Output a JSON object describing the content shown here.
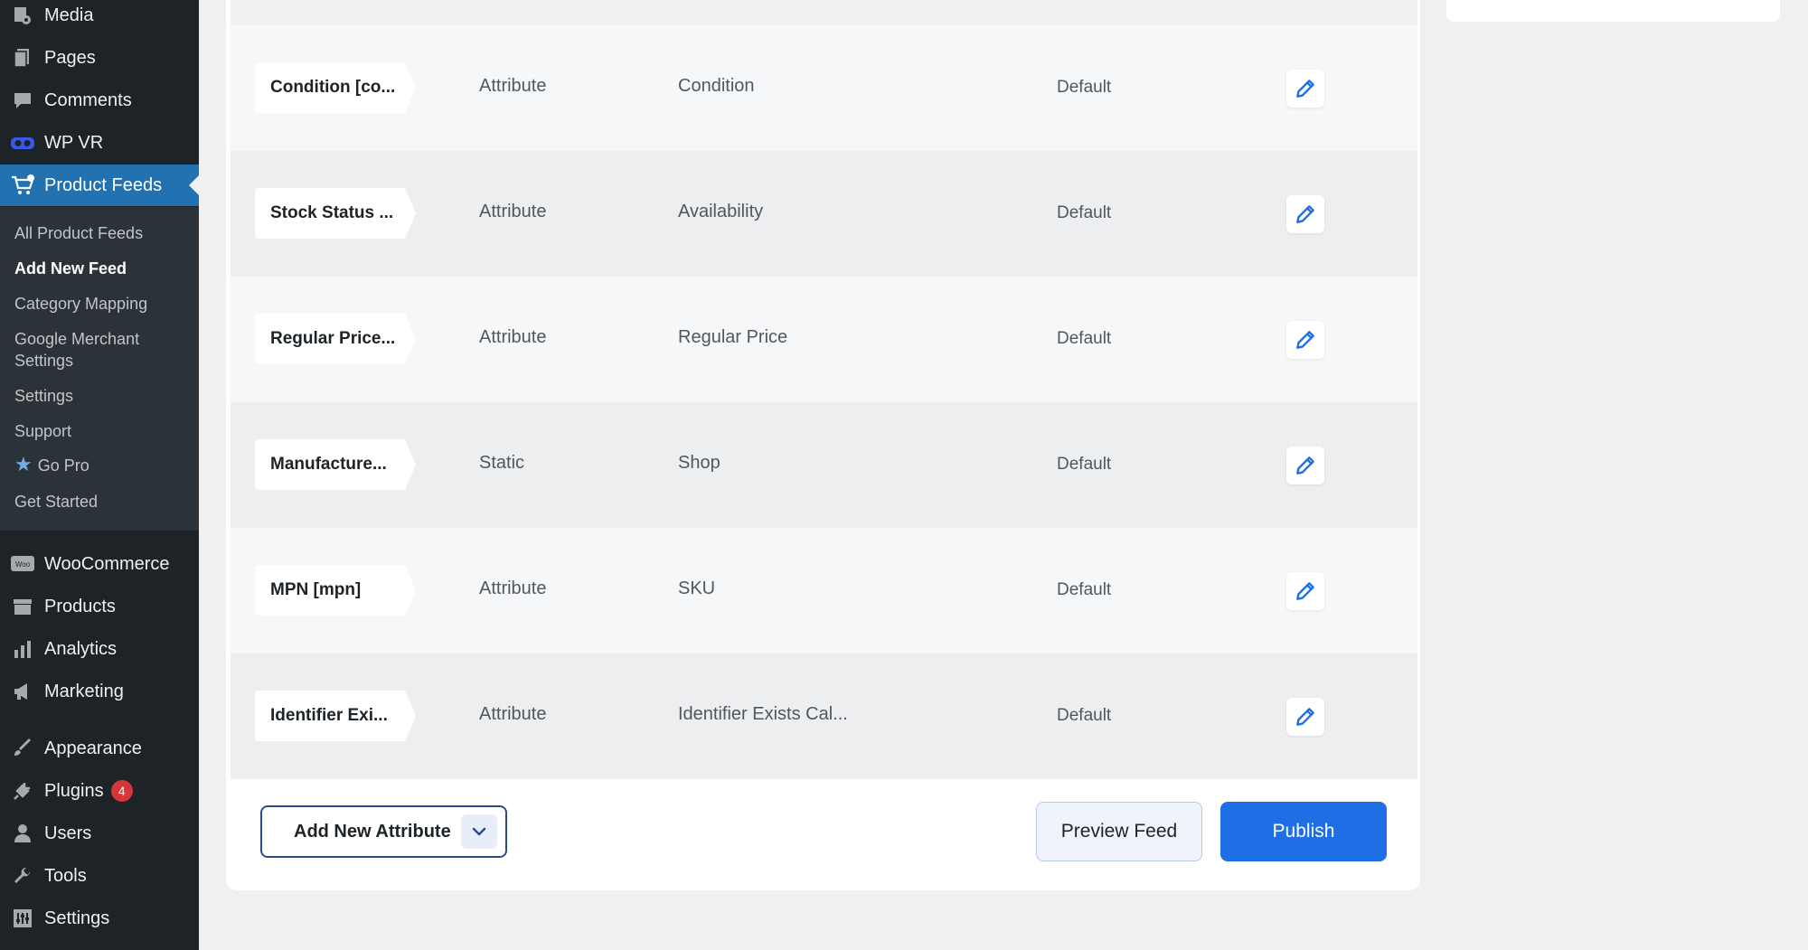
{
  "sidebar": {
    "menu": [
      {
        "label": "Media",
        "icon": "media-icon"
      },
      {
        "label": "Pages",
        "icon": "pages-icon"
      },
      {
        "label": "Comments",
        "icon": "comments-icon"
      },
      {
        "label": "WP VR",
        "icon": "vr-icon"
      },
      {
        "label": "Product Feeds",
        "icon": "cart-icon"
      }
    ],
    "submenu": [
      {
        "label": "All Product Feeds"
      },
      {
        "label": "Add New Feed"
      },
      {
        "label": "Category Mapping"
      },
      {
        "label": "Google Merchant"
      },
      {
        "label": "Settings"
      },
      {
        "label": "Settings"
      },
      {
        "label": "Support"
      },
      {
        "label": "Go Pro"
      },
      {
        "label": "Get Started"
      }
    ],
    "menu2": [
      {
        "label": "WooCommerce",
        "icon": "woo-icon"
      },
      {
        "label": "Products",
        "icon": "products-icon"
      },
      {
        "label": "Analytics",
        "icon": "analytics-icon"
      },
      {
        "label": "Marketing",
        "icon": "megaphone-icon"
      },
      {
        "label": "Appearance",
        "icon": "brush-icon"
      },
      {
        "label": "Plugins",
        "icon": "plug-icon",
        "badge": "4"
      },
      {
        "label": "Users",
        "icon": "user-icon"
      },
      {
        "label": "Tools",
        "icon": "wrench-icon"
      },
      {
        "label": "Settings",
        "icon": "settings-icon"
      }
    ],
    "woo_icon_text": "Woo",
    "accent": "#2271b1"
  },
  "rows": [
    {
      "name": "Condition [co...",
      "type": "Attribute",
      "value": "Condition",
      "output": "Default"
    },
    {
      "name": "Stock Status ...",
      "type": "Attribute",
      "value": "Availability",
      "output": "Default"
    },
    {
      "name": "Regular Price...",
      "type": "Attribute",
      "value": "Regular Price",
      "output": "Default"
    },
    {
      "name": "Manufacture...",
      "type": "Static",
      "value": "Shop",
      "output": "Default"
    },
    {
      "name": "MPN [mpn]",
      "type": "Attribute",
      "value": "SKU",
      "output": "Default"
    },
    {
      "name": "Identifier Exi...",
      "type": "Attribute",
      "value": "Identifier Exists Cal...",
      "output": "Default"
    }
  ],
  "footer": {
    "add_attribute": "Add New Attribute",
    "preview": "Preview Feed",
    "publish": "Publish",
    "publish_color": "#1e6fe6"
  }
}
